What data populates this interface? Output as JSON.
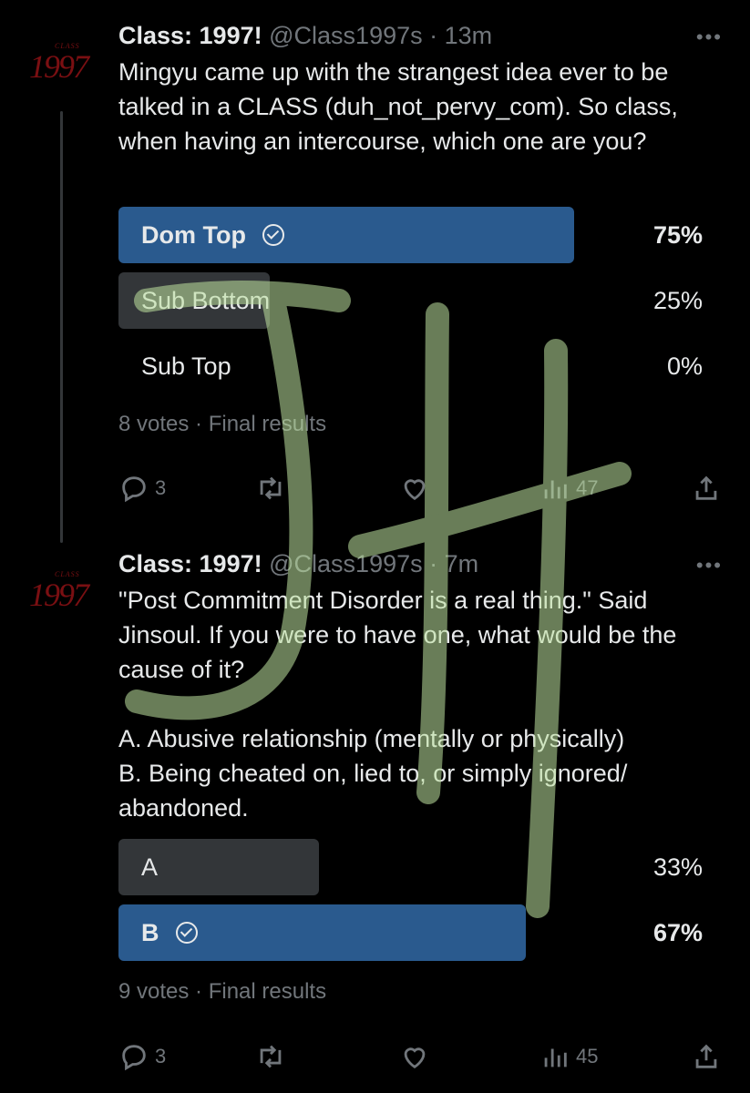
{
  "tweets": [
    {
      "avatar_small": "CLASS",
      "avatar_big": "1997",
      "name": "Class: 1997!",
      "handle": "@Class1997s",
      "time": "13m",
      "text": "Mingyu came up with the strangest idea ever to be talked in a CLASS (duh_not_pervy_com). So class, when having an intercourse, which one are you?",
      "poll": [
        {
          "label": "Dom Top",
          "percent": "75%",
          "winner": true
        },
        {
          "label": "Sub Bottom",
          "percent": "25%",
          "winner": false
        },
        {
          "label": "Sub Top",
          "percent": "0%",
          "winner": false
        }
      ],
      "results": "8 votes · Final results",
      "replies": "3",
      "views": "47"
    },
    {
      "avatar_small": "CLASS",
      "avatar_big": "1997",
      "name": "Class: 1997!",
      "handle": "@Class1997s",
      "time": "7m",
      "text": "\"Post Commitment Disorder is a real thing.\" Said Jinsoul. If you were to have one, what would be the cause of it?\n\nA. Abusive relationship (mentally or physically)\nB. Being cheated on, lied to, or simply ignored/ abandoned.",
      "poll": [
        {
          "label": "A",
          "percent": "33%",
          "winner": false
        },
        {
          "label": "B",
          "percent": "67%",
          "winner": true
        }
      ],
      "results": "9 votes · Final results",
      "replies": "3",
      "views": "45"
    }
  ],
  "colors": {
    "winner_bar": "#2a5a8e",
    "other_bar": "#333639",
    "muted": "#71767b",
    "overlay": "#bfe3a0"
  },
  "icons": [
    "reply-icon",
    "retweet-icon",
    "like-icon",
    "views-icon",
    "share-icon",
    "more-icon"
  ]
}
